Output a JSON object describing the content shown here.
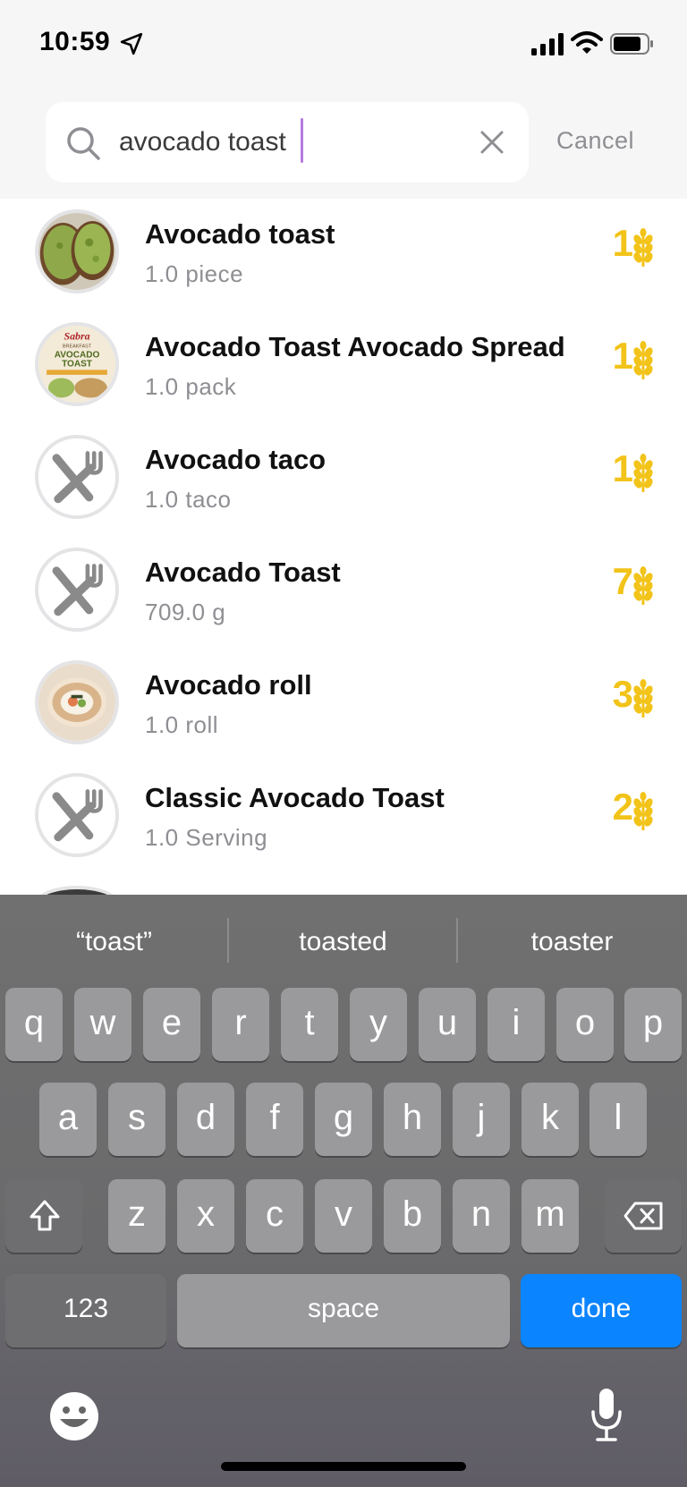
{
  "status_bar": {
    "time": "10:59"
  },
  "search": {
    "query": "avocado toast",
    "cancel_label": "Cancel"
  },
  "results": [
    {
      "name": "Avocado toast",
      "serving": "1.0 piece",
      "carb": "1",
      "thumb": "photo-avocado-toast"
    },
    {
      "name": "Avocado Toast Avocado Spread",
      "serving": "1.0 pack",
      "carb": "1",
      "thumb": "photo-sabra-package"
    },
    {
      "name": "Avocado taco",
      "serving": "1.0 taco",
      "carb": "1",
      "thumb": "utensils-icon"
    },
    {
      "name": "Avocado Toast",
      "serving": "709.0 g",
      "carb": "7",
      "thumb": "utensils-icon"
    },
    {
      "name": "Avocado roll",
      "serving": "1.0 roll",
      "carb": "3",
      "thumb": "photo-sushi-roll"
    },
    {
      "name": "Classic Avocado Toast",
      "serving": "1.0 Serving",
      "carb": "2",
      "thumb": "utensils-icon"
    }
  ],
  "thumb_text": {
    "brand": "Sabra",
    "line1": "BREAKFAST",
    "line2": "AVOCADO",
    "line3": "TOAST"
  },
  "keyboard": {
    "suggestions": [
      "“toast”",
      "toasted",
      "toaster"
    ],
    "row1": [
      "q",
      "w",
      "e",
      "r",
      "t",
      "y",
      "u",
      "i",
      "o",
      "p"
    ],
    "row2": [
      "a",
      "s",
      "d",
      "f",
      "g",
      "h",
      "j",
      "k",
      "l"
    ],
    "row3": [
      "z",
      "x",
      "c",
      "v",
      "b",
      "n",
      "m"
    ],
    "numbers_label": "123",
    "space_label": "space",
    "done_label": "done"
  },
  "colors": {
    "carb_accent": "#f2c318",
    "done_key": "#0a84ff",
    "caret": "#b57be0"
  }
}
